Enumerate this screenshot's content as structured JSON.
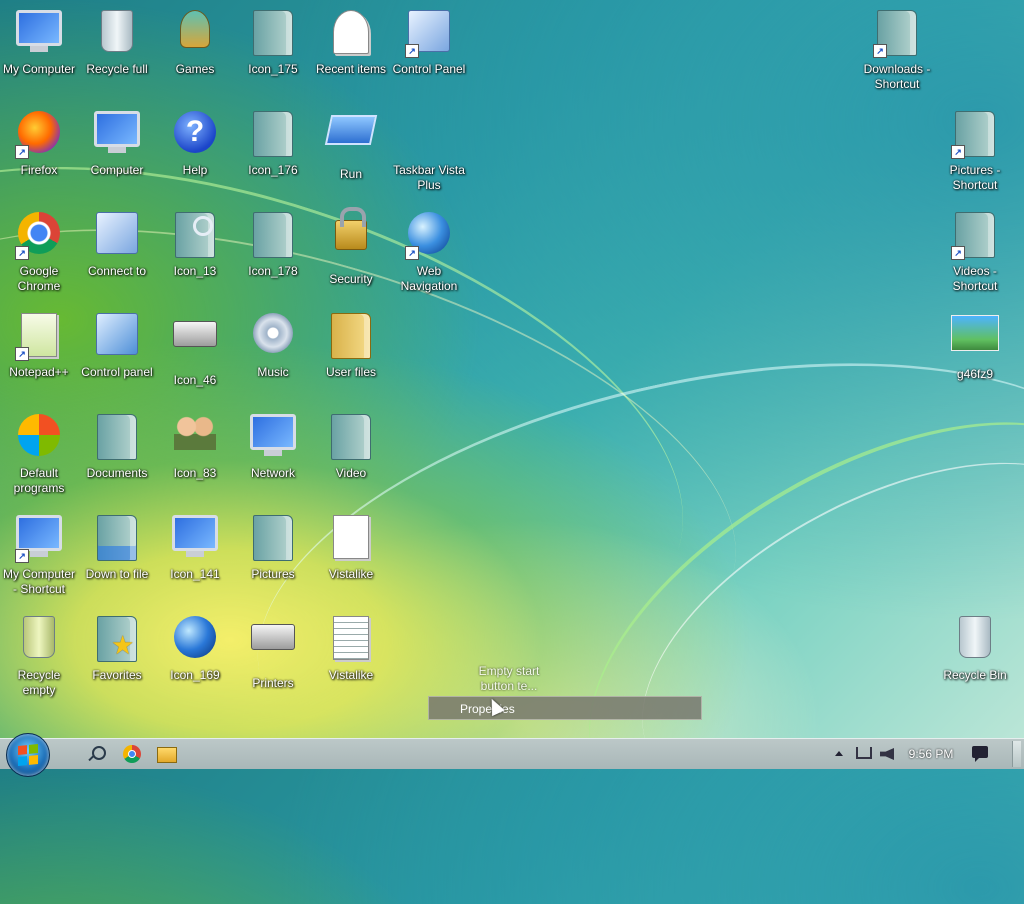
{
  "desktop": {
    "icons": [
      {
        "label": "My Computer"
      },
      {
        "label": "Recycle full"
      },
      {
        "label": "Games"
      },
      {
        "label": "Icon_175"
      },
      {
        "label": "Recent items"
      },
      {
        "label": "Control Panel"
      },
      {
        "label": "Firefox"
      },
      {
        "label": "Computer"
      },
      {
        "label": "Help"
      },
      {
        "label": "Icon_176"
      },
      {
        "label": "Run"
      },
      {
        "label": "Taskbar Vista\nPlus"
      },
      {
        "label": "Google\nChrome"
      },
      {
        "label": "Connect to"
      },
      {
        "label": "Icon_13"
      },
      {
        "label": "Icon_178"
      },
      {
        "label": "Security"
      },
      {
        "label": "Web\nNavigation"
      },
      {
        "label": "Notepad++"
      },
      {
        "label": "Control panel"
      },
      {
        "label": "Icon_46"
      },
      {
        "label": "Music"
      },
      {
        "label": "User files"
      },
      {
        "label": "Default\nprograms"
      },
      {
        "label": "Documents"
      },
      {
        "label": "Icon_83"
      },
      {
        "label": "Network"
      },
      {
        "label": "Video"
      },
      {
        "label": "My Computer\n- Shortcut"
      },
      {
        "label": "Down to file"
      },
      {
        "label": "Icon_141"
      },
      {
        "label": "Pictures"
      },
      {
        "label": "Vistalike"
      },
      {
        "label": "Recycle\nempty"
      },
      {
        "label": "Favorites"
      },
      {
        "label": "Icon_169"
      },
      {
        "label": "Printers"
      },
      {
        "label": "Vistalike"
      },
      {
        "label": "Downloads -\nShortcut"
      },
      {
        "label": "Pictures -\nShortcut"
      },
      {
        "label": "Videos -\nShortcut"
      },
      {
        "label": "g46fz9"
      },
      {
        "label": "Recycle Bin"
      }
    ]
  },
  "context_menu": {
    "description": "Empty start\nbutton te...",
    "item_properties": "Properties"
  },
  "taskbar": {
    "clock": "9:56 PM"
  },
  "colors": {
    "taskbar": "#b3c0c1",
    "menu_bg": "#78786e"
  }
}
